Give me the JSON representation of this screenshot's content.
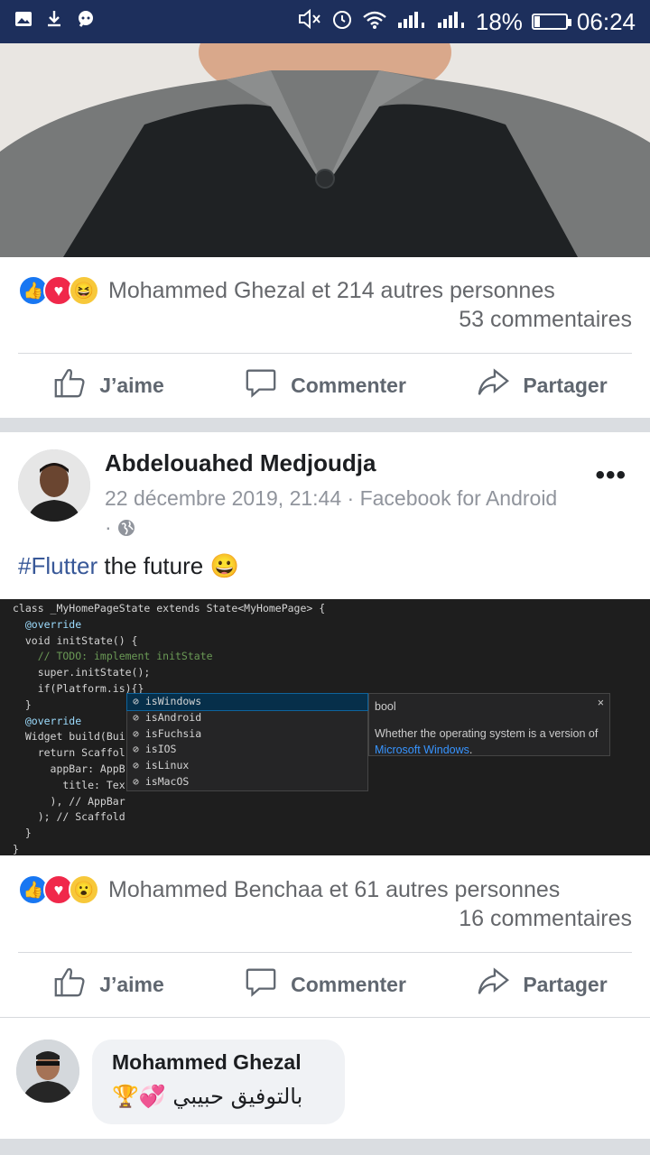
{
  "status_bar": {
    "battery": "18%",
    "time": "06:24",
    "battery_level": 0.18
  },
  "post1": {
    "reactions_text": "Mohammed Ghezal et 214 autres personnes",
    "comments": "53 commentaires",
    "reaction_icons": [
      "like",
      "love",
      "haha"
    ]
  },
  "actions": {
    "like": "J’aime",
    "comment": "Commenter",
    "share": "Partager"
  },
  "post2": {
    "author": "Abdelouahed Medjoudja",
    "meta": "22 décembre 2019, 21:44 · Facebook for Android",
    "meta_suffix": "·",
    "more": "•••",
    "hashtag": "#Flutter",
    "text": " the future ",
    "emoji": "😀",
    "reactions_text": "Mohammed Benchaa et 61 autres personnes",
    "comments": "16 commentaires",
    "reaction_icons": [
      "like",
      "love",
      "wow"
    ],
    "code": {
      "lines": [
        "class _MyHomePageState extends State<MyHomePage> {",
        "  @override",
        "  void initState() {",
        "    // TODO: implement initState",
        "    super.initState();",
        "    if(Platform.is){}",
        "  }",
        "  @override",
        "  Widget build(Bui",
        "    return Scaffol",
        "      appBar: AppB",
        "        title: Tex",
        "      ), // AppBar",
        "    ); // Scaffold",
        "  }",
        "}"
      ],
      "suggestions": [
        "isWindows",
        "isAndroid",
        "isFuchsia",
        "isIOS",
        "isLinux",
        "isMacOS"
      ],
      "detail_type": "bool",
      "detail_text": "Whether the operating system is a version of",
      "detail_link": "Microsoft Windows",
      "detail_end": ".",
      "close": "×"
    }
  },
  "comment": {
    "author": "Mohammed Ghezal",
    "text": "بالتوفيق حبيبي 💞🏆"
  }
}
